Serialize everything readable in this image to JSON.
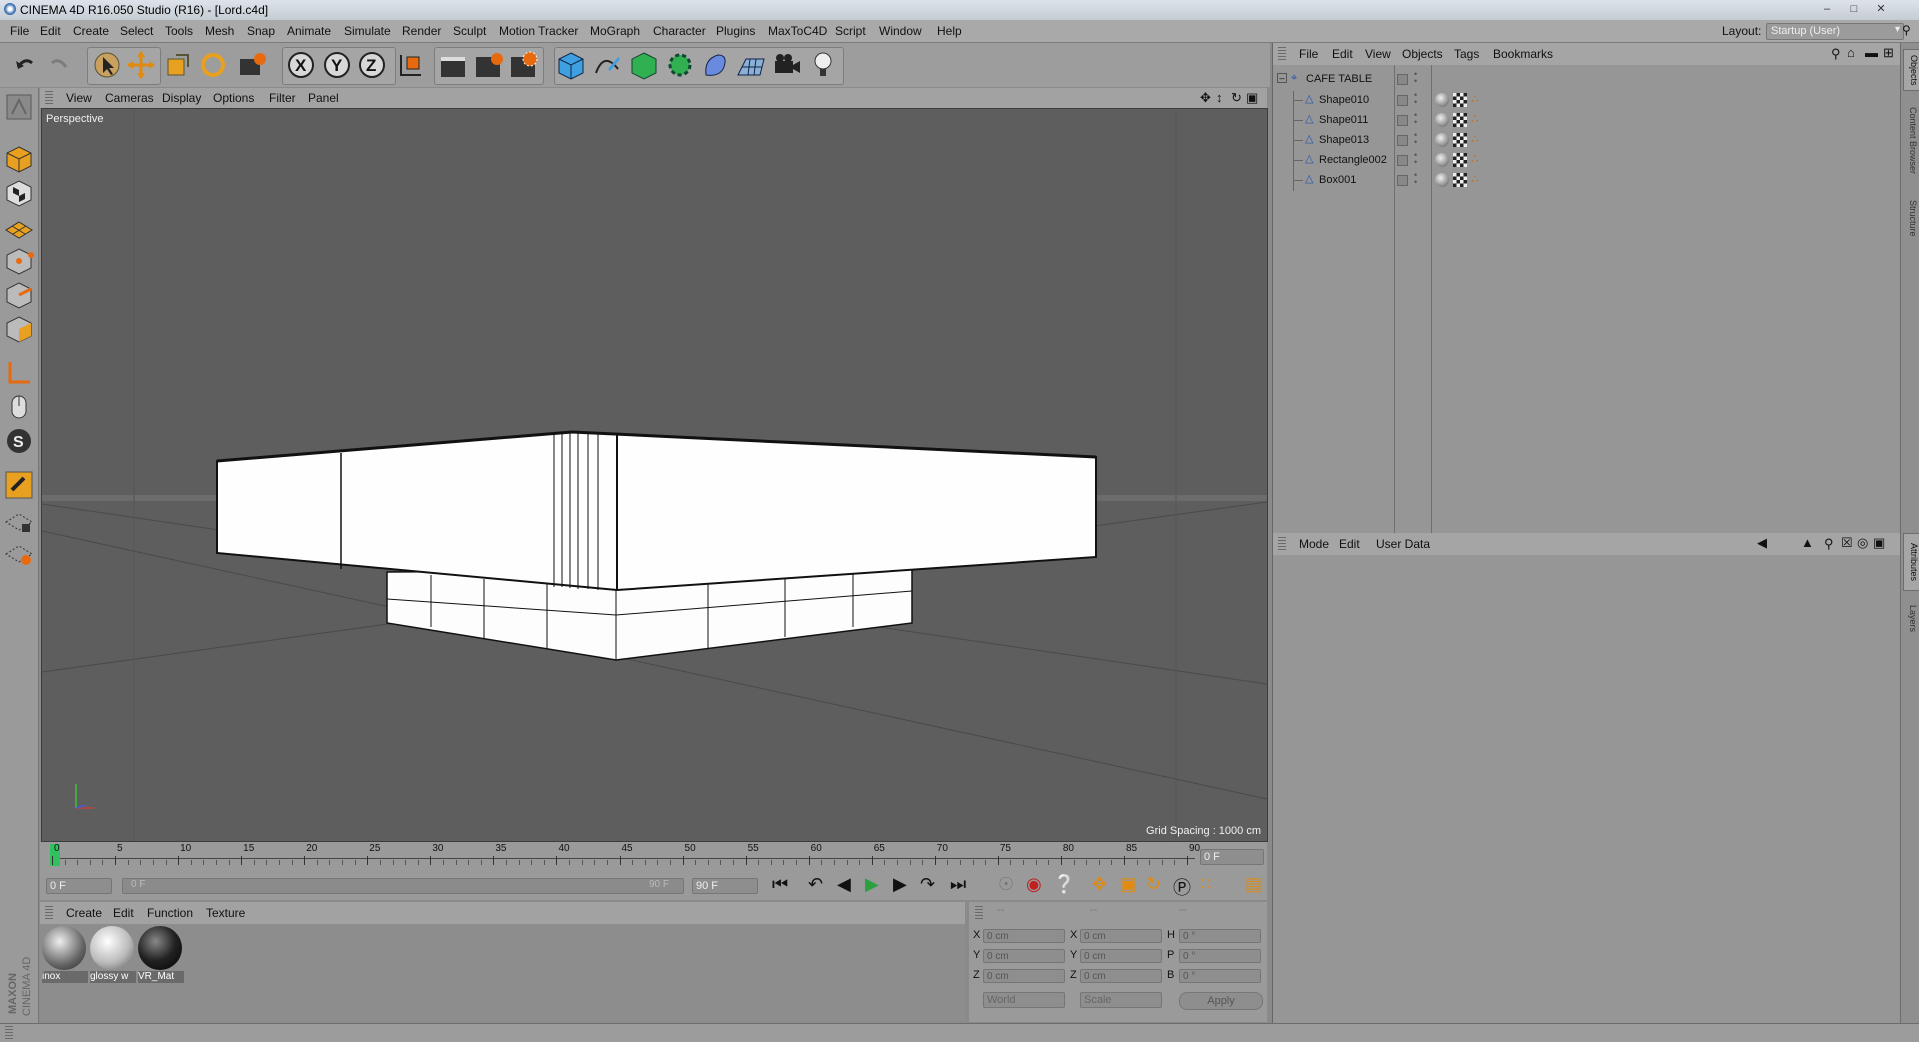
{
  "window": {
    "title": "CINEMA 4D R16.050 Studio (R16) - [Lord.c4d]"
  },
  "menubar": {
    "items": [
      "File",
      "Edit",
      "Create",
      "Select",
      "Tools",
      "Mesh",
      "Snap",
      "Animate",
      "Simulate",
      "Render",
      "Sculpt",
      "Motion Tracker",
      "MoGraph",
      "Character",
      "Plugins",
      "MaxToC4D",
      "Script",
      "Window",
      "Help"
    ],
    "layout_label": "Layout:",
    "layout_value": "Startup (User)"
  },
  "viewport": {
    "menu": [
      "View",
      "Cameras",
      "Display",
      "Options",
      "Filter",
      "Panel"
    ],
    "label": "Perspective",
    "grid_spacing": "Grid Spacing : 1000 cm"
  },
  "timeline": {
    "ticks": [
      "0",
      "5",
      "10",
      "15",
      "20",
      "25",
      "30",
      "35",
      "40",
      "45",
      "50",
      "55",
      "60",
      "65",
      "70",
      "75",
      "80",
      "85",
      "90"
    ],
    "current_frame": "0 F",
    "start_field": "0 F",
    "range_start": "0 F",
    "range_end": "90 F",
    "end_field": "90 F"
  },
  "materials": {
    "menu": [
      "Create",
      "Edit",
      "Function",
      "Texture"
    ],
    "items": [
      {
        "name": "inox"
      },
      {
        "name": "glossy w"
      },
      {
        "name": "VR_Mat"
      }
    ]
  },
  "coordinates": {
    "headers": [
      "--",
      "--",
      "--"
    ],
    "rows": [
      {
        "a_label": "X",
        "a_val": "0 cm",
        "b_label": "X",
        "b_val": "0 cm",
        "c_label": "H",
        "c_val": "0 °"
      },
      {
        "a_label": "Y",
        "a_val": "0 cm",
        "b_label": "Y",
        "b_val": "0 cm",
        "c_label": "P",
        "c_val": "0 °"
      },
      {
        "a_label": "Z",
        "a_val": "0 cm",
        "b_label": "Z",
        "b_val": "0 cm",
        "c_label": "B",
        "c_val": "0 °"
      }
    ],
    "mode_world": "World",
    "mode_scale": "Scale",
    "apply_label": "Apply"
  },
  "object_manager": {
    "menu": [
      "File",
      "Edit",
      "View",
      "Objects",
      "Tags",
      "Bookmarks"
    ],
    "root": "CAFE TABLE",
    "objects": [
      "Shape010",
      "Shape011",
      "Shape013",
      "Rectangle002",
      "Box001"
    ]
  },
  "attribute_manager": {
    "menu": [
      "Mode",
      "Edit",
      "User Data"
    ]
  },
  "right_tabs": [
    "Objects",
    "Content Browser",
    "Structure",
    "Attributes",
    "Layers"
  ],
  "brand": "MAXON CINEMA 4D",
  "colors": {
    "viewport_bg": "#5e5e5e",
    "panel_bg": "#969696",
    "accent_green": "#30c060"
  }
}
